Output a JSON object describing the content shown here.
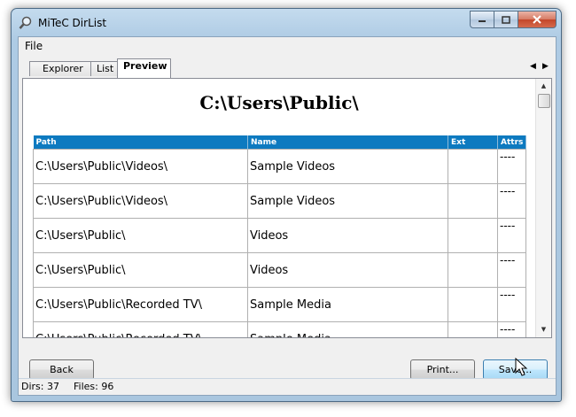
{
  "window": {
    "title": "MiTeC DirList"
  },
  "menu": {
    "file": "File"
  },
  "tabs": [
    {
      "label": "Explorer"
    },
    {
      "label": "List"
    },
    {
      "label": "Preview"
    }
  ],
  "preview": {
    "heading": "C:\\Users\\Public\\",
    "columns": [
      "Path",
      "Name",
      "Ext",
      "Attrs"
    ],
    "rows": [
      {
        "path": "C:\\Users\\Public\\Videos\\",
        "name": "Sample Videos",
        "ext": "",
        "attrs": "----"
      },
      {
        "path": "C:\\Users\\Public\\Videos\\",
        "name": "Sample Videos",
        "ext": "",
        "attrs": "----"
      },
      {
        "path": "C:\\Users\\Public\\",
        "name": "Videos",
        "ext": "",
        "attrs": "----"
      },
      {
        "path": "C:\\Users\\Public\\",
        "name": "Videos",
        "ext": "",
        "attrs": "----"
      },
      {
        "path": "C:\\Users\\Public\\Recorded TV\\",
        "name": "Sample Media",
        "ext": "",
        "attrs": "----"
      },
      {
        "path": "C:\\Users\\Public\\Recorded TV\\",
        "name": "Sample Media",
        "ext": "",
        "attrs": "----"
      }
    ]
  },
  "buttons": {
    "back": "Back",
    "print": "Print...",
    "save": "Save..."
  },
  "status": {
    "dirs": "Dirs: 37",
    "files": "Files: 96"
  },
  "colors": {
    "header_bg": "#0d7ac0",
    "header_text": "#ffffff",
    "close_button": "#c3462a"
  }
}
